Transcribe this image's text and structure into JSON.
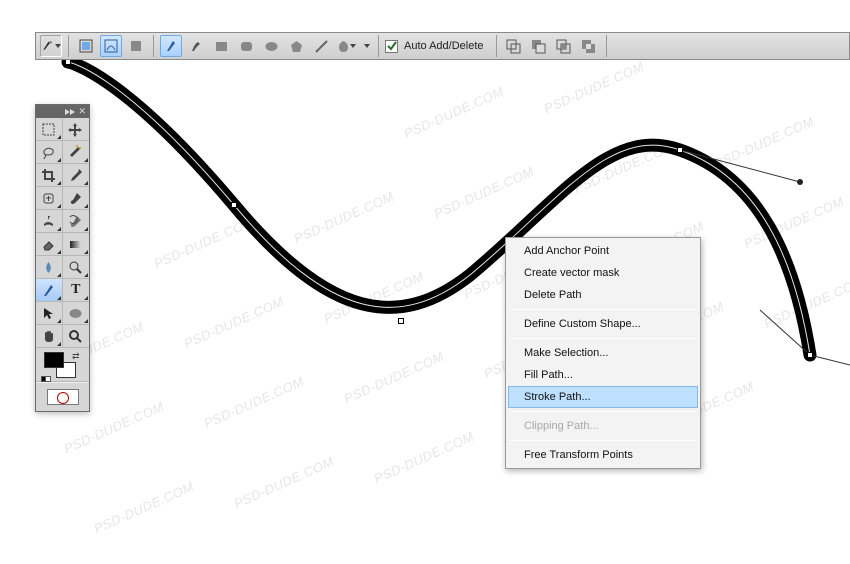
{
  "options_bar": {
    "auto_add_delete_checked": true,
    "auto_add_delete_label": "Auto Add/Delete"
  },
  "tools_panel": {
    "tools": [
      "marquee",
      "move",
      "lasso",
      "magic-wand",
      "crop",
      "eyedropper",
      "healing-brush",
      "brush",
      "clone-stamp",
      "history-brush",
      "eraser",
      "gradient",
      "blur",
      "dodge",
      "pen",
      "type",
      "path-select",
      "ellipse",
      "hand",
      "zoom"
    ],
    "selected": "pen"
  },
  "context_menu": {
    "items": [
      {
        "label": "Add Anchor Point",
        "enabled": true
      },
      {
        "label": "Create vector mask",
        "enabled": true
      },
      {
        "label": "Delete Path",
        "enabled": true
      },
      {
        "sep": true
      },
      {
        "label": "Define Custom Shape...",
        "enabled": true
      },
      {
        "sep": true
      },
      {
        "label": "Make Selection...",
        "enabled": true
      },
      {
        "label": "Fill Path...",
        "enabled": true
      },
      {
        "label": "Stroke Path...",
        "enabled": true,
        "selected": true
      },
      {
        "sep": true
      },
      {
        "label": "Clipping Path...",
        "enabled": false
      },
      {
        "sep": true
      },
      {
        "label": "Free Transform Points",
        "enabled": true
      }
    ]
  },
  "watermark_text": "PSD-DUDE.COM",
  "colors": {
    "selection_blue": "#bde1ff",
    "panel_gray": "#d6d6d6",
    "path_black": "#000000"
  }
}
